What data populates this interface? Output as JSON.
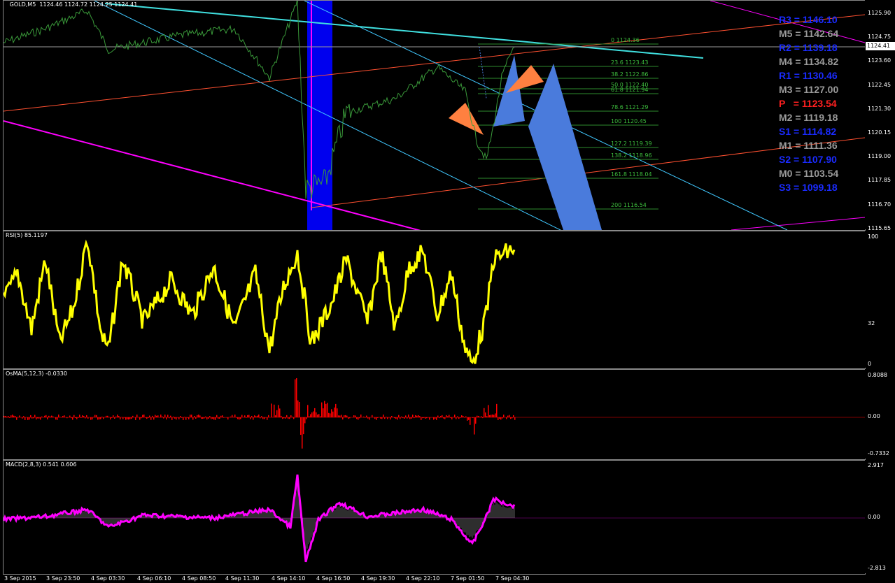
{
  "symbol": "GOLD,M5",
  "ohlc": "1124.46 1124.72 1124.25 1124.41",
  "current_price": "1124.41",
  "main_axis": [
    "1125.90",
    "1124.75",
    "1123.60",
    "1122.45",
    "1121.30",
    "1120.15",
    "1119.00",
    "1117.85",
    "1116.70",
    "1115.65"
  ],
  "fib_levels": [
    {
      "text": "0 1124.36"
    },
    {
      "text": "23.6 1123.43"
    },
    {
      "text": "38.2 1122.86"
    },
    {
      "text": "50.0 1122.40"
    },
    {
      "text": "61.8 1121.94"
    },
    {
      "text": "78.6 1121.29"
    },
    {
      "text": "100 1120.45"
    },
    {
      "text": "127.2 1119.39"
    },
    {
      "text": "138.2 1118.96"
    },
    {
      "text": "161.8 1118.04"
    },
    {
      "text": "200 1116.54"
    }
  ],
  "pivots": [
    {
      "text": "R3 = 1146.10",
      "color": "#1a2bff"
    },
    {
      "text": "M5 = 1142.64",
      "color": "#9a9a9a"
    },
    {
      "text": "R2 = 1139.18",
      "color": "#1a2bff"
    },
    {
      "text": "M4 = 1134.82",
      "color": "#9a9a9a"
    },
    {
      "text": "R1 = 1130.46",
      "color": "#1a2bff"
    },
    {
      "text": "M3 = 1127.00",
      "color": "#9a9a9a"
    },
    {
      "text": "P   = 1123.54",
      "color": "#ff2020"
    },
    {
      "text": "M2 = 1119.18",
      "color": "#9a9a9a"
    },
    {
      "text": "S1 = 1114.82",
      "color": "#1a2bff"
    },
    {
      "text": "M1 = 1111.36",
      "color": "#9a9a9a"
    },
    {
      "text": "S2 = 1107.90",
      "color": "#1a2bff"
    },
    {
      "text": "M0 = 1103.54",
      "color": "#9a9a9a"
    },
    {
      "text": "S3 = 1099.18",
      "color": "#1a2bff"
    }
  ],
  "rsi": {
    "label": "RSI(5) 85.1197",
    "axis": [
      "100",
      "32",
      "0"
    ]
  },
  "osma": {
    "label": "OsMA(5,12,3) -0.0330",
    "axis": [
      "0.8088",
      "0.00",
      "-0.7332"
    ]
  },
  "macd": {
    "label": "MACD(2,8,3) 0.541 0.606",
    "axis": [
      "2.917",
      "0.00",
      "-2.813"
    ]
  },
  "time_labels": [
    "3 Sep 2015",
    "3 Sep 23:50",
    "4 Sep 03:30",
    "4 Sep 06:10",
    "4 Sep 08:50",
    "4 Sep 11:30",
    "4 Sep 14:10",
    "4 Sep 16:50",
    "4 Sep 19:30",
    "4 Sep 22:10",
    "7 Sep 01:50",
    "7 Sep 04:30"
  ],
  "colors": {
    "price": "#3a9a3a",
    "rsi": "#ffff00",
    "osma": "#ff0000",
    "macd": "#ff00ff",
    "pattern": "#4a7bdc",
    "arrow": "#ff8040",
    "session": "#0000ee"
  }
}
